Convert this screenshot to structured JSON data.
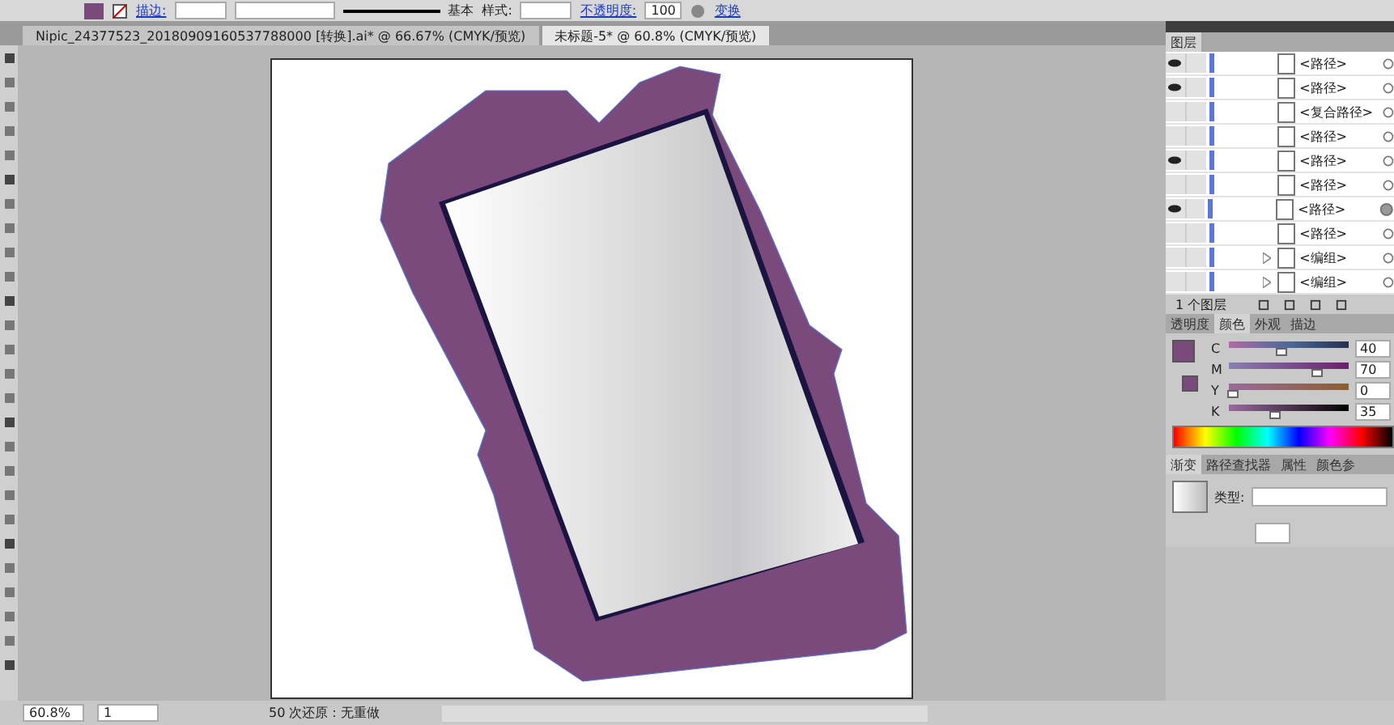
{
  "control_bar": {
    "stroke_label": "描边:",
    "brush_label": "基本",
    "style_label": "样式:",
    "opacity_label": "不透明度:",
    "opacity_value": "100",
    "transform_link": "变换"
  },
  "document_tabs": [
    {
      "title": "Nipic_24377523_20180909160537788000 [转换].ai* @ 66.67% (CMYK/预览)",
      "selected": false
    },
    {
      "title": "未标题-5* @ 60.8% (CMYK/预览)",
      "selected": true
    }
  ],
  "layers_panel": {
    "title": "图层",
    "rows": [
      {
        "name": "<路径>",
        "visible": true,
        "expandable": false,
        "targeted": false
      },
      {
        "name": "<路径>",
        "visible": true,
        "expandable": false,
        "targeted": false
      },
      {
        "name": "<复合路径>",
        "visible": false,
        "expandable": false,
        "targeted": false
      },
      {
        "name": "<路径>",
        "visible": false,
        "expandable": false,
        "targeted": false
      },
      {
        "name": "<路径>",
        "visible": true,
        "expandable": false,
        "targeted": false
      },
      {
        "name": "<路径>",
        "visible": false,
        "expandable": false,
        "targeted": false
      },
      {
        "name": "<路径>",
        "visible": true,
        "expandable": false,
        "targeted": true
      },
      {
        "name": "<路径>",
        "visible": false,
        "expandable": false,
        "targeted": false
      },
      {
        "name": "<编组>",
        "visible": false,
        "expandable": true,
        "targeted": false
      },
      {
        "name": "<编组>",
        "visible": false,
        "expandable": true,
        "targeted": false
      }
    ],
    "count": "1 个图层"
  },
  "color_panel": {
    "tabs": [
      {
        "label": "透明度",
        "selected": false
      },
      {
        "label": "颜色",
        "selected": true
      },
      {
        "label": "外观",
        "selected": false
      },
      {
        "label": "描边",
        "selected": false
      }
    ],
    "channels": [
      {
        "name": "C",
        "value": "40",
        "level": 0.4
      },
      {
        "name": "M",
        "value": "70",
        "level": 0.7
      },
      {
        "name": "Y",
        "value": "0",
        "level": 0.0
      },
      {
        "name": "K",
        "value": "35",
        "level": 0.35
      }
    ]
  },
  "gradient_panel": {
    "tabs": [
      {
        "label": "渐变",
        "selected": true
      },
      {
        "label": "路径查找器",
        "selected": false
      },
      {
        "label": "属性",
        "selected": false
      },
      {
        "label": "颜色参",
        "selected": false
      }
    ],
    "type_label": "类型:"
  },
  "status_bar": {
    "zoom": "60.8%",
    "page": "1",
    "status": "50 次还原：无重做"
  }
}
